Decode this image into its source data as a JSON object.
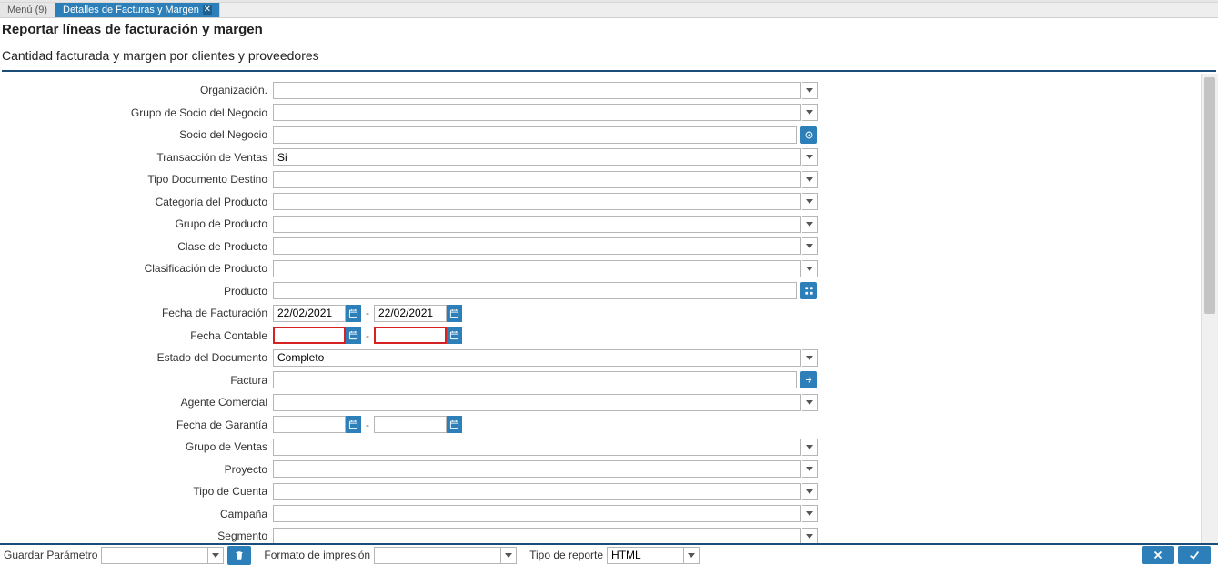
{
  "tabs": {
    "menu": "Menú (9)",
    "active": "Detalles de Facturas y Margen"
  },
  "heading": {
    "title": "Reportar líneas de facturación y margen",
    "subtitle": "Cantidad facturada y margen por clientes y proveedores"
  },
  "labels": {
    "organizacion": "Organización.",
    "grupo_socio": "Grupo de Socio del Negocio",
    "socio": "Socio del Negocio",
    "trans_ventas": "Transacción de Ventas",
    "tipo_doc_dest": "Tipo Documento Destino",
    "cat_prod": "Categoría del Producto",
    "grupo_prod": "Grupo de Producto",
    "clase_prod": "Clase de Producto",
    "clasif_prod": "Clasificación de Producto",
    "producto": "Producto",
    "fecha_fact": "Fecha de Facturación",
    "fecha_cont": "Fecha Contable",
    "estado_doc": "Estado del Documento",
    "factura": "Factura",
    "agente": "Agente Comercial",
    "fecha_garantia": "Fecha de Garantía",
    "grupo_ventas": "Grupo de Ventas",
    "proyecto": "Proyecto",
    "tipo_cuenta": "Tipo de Cuenta",
    "campana": "Campaña",
    "segmento": "Segmento"
  },
  "values": {
    "trans_ventas": "Si",
    "fecha_fact_from": "22/02/2021",
    "fecha_fact_to": "22/02/2021",
    "fecha_cont_from": "",
    "fecha_cont_to": "",
    "estado_doc": "Completo",
    "fecha_garantia_from": "",
    "fecha_garantia_to": ""
  },
  "footer": {
    "guardar_param": "Guardar Parámetro",
    "formato_impresion": "Formato de impresión",
    "tipo_reporte": "Tipo de reporte",
    "tipo_reporte_value": "HTML"
  }
}
